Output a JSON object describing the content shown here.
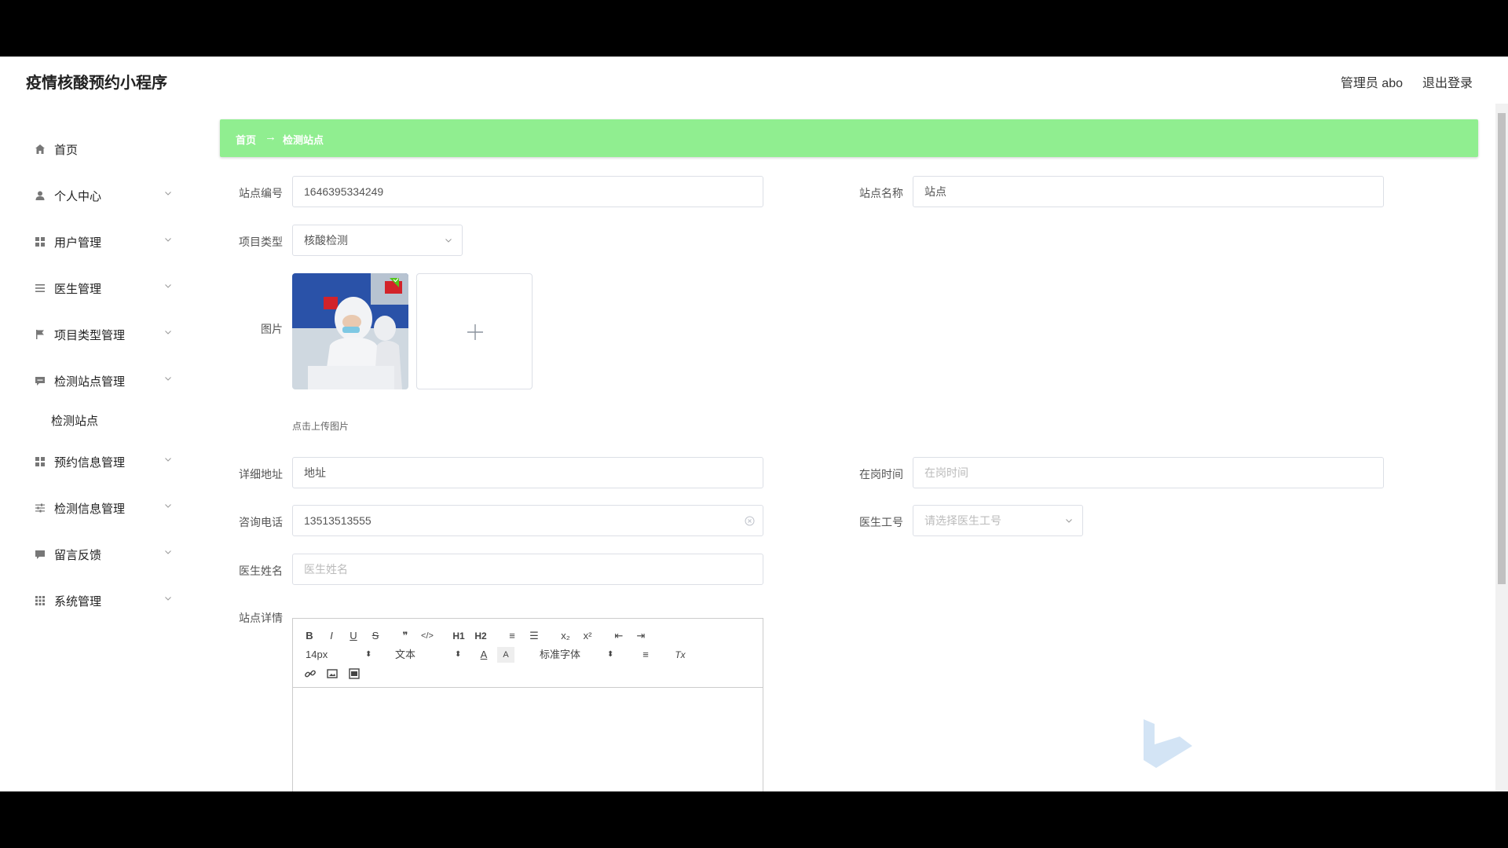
{
  "app": {
    "title": "疫情核酸预约小程序",
    "admin": "管理员 abo",
    "logout": "退出登录"
  },
  "sidebar": {
    "items": [
      {
        "label": "首页",
        "icon": "home-icon",
        "hasArrow": false
      },
      {
        "label": "个人中心",
        "icon": "user-icon",
        "hasArrow": true
      },
      {
        "label": "用户管理",
        "icon": "grid-icon",
        "hasArrow": true
      },
      {
        "label": "医生管理",
        "icon": "list-icon",
        "hasArrow": true
      },
      {
        "label": "项目类型管理",
        "icon": "flag-icon",
        "hasArrow": true
      },
      {
        "label": "检测站点管理",
        "icon": "chat-icon",
        "hasArrow": true
      },
      {
        "label": "预约信息管理",
        "icon": "grid-icon",
        "hasArrow": true
      },
      {
        "label": "检测信息管理",
        "icon": "sliders-icon",
        "hasArrow": true
      },
      {
        "label": "留言反馈",
        "icon": "message-icon",
        "hasArrow": true
      },
      {
        "label": "系统管理",
        "icon": "apps-icon",
        "hasArrow": true
      }
    ],
    "submenu": {
      "label": "检测站点"
    }
  },
  "breadcrumb": {
    "home": "首页",
    "arrow": "→",
    "current": "检测站点"
  },
  "form": {
    "station_no": {
      "label": "站点编号",
      "value": "1646395334249"
    },
    "station_name": {
      "label": "站点名称",
      "value": "站点"
    },
    "project_type": {
      "label": "项目类型",
      "value": "核酸检测"
    },
    "image": {
      "label": "图片",
      "tip": "点击上传图片",
      "add": "+"
    },
    "address": {
      "label": "详细地址",
      "value": "地址"
    },
    "on_duty": {
      "label": "在岗时间",
      "placeholder": "在岗时间"
    },
    "phone": {
      "label": "咨询电话",
      "value": "13513513555"
    },
    "doctor_no": {
      "label": "医生工号",
      "placeholder": "请选择医生工号"
    },
    "doctor_name": {
      "label": "医生姓名",
      "placeholder": "医生姓名"
    },
    "detail": {
      "label": "站点详情"
    }
  },
  "editor": {
    "row1": [
      "B",
      "I",
      "U",
      "S",
      "❞",
      "</>",
      "H1",
      "H2",
      "≡",
      "☰",
      "x₂",
      "x²",
      "⇤",
      "⇥"
    ],
    "size": "14px",
    "header": "文本",
    "text_color": "A",
    "bg_color": "A",
    "font": "标准字体",
    "align": "≡",
    "clean": "Tx"
  },
  "colors": {
    "breadcrumb_bg": "#90ee90",
    "border": "#dcdfe6"
  }
}
